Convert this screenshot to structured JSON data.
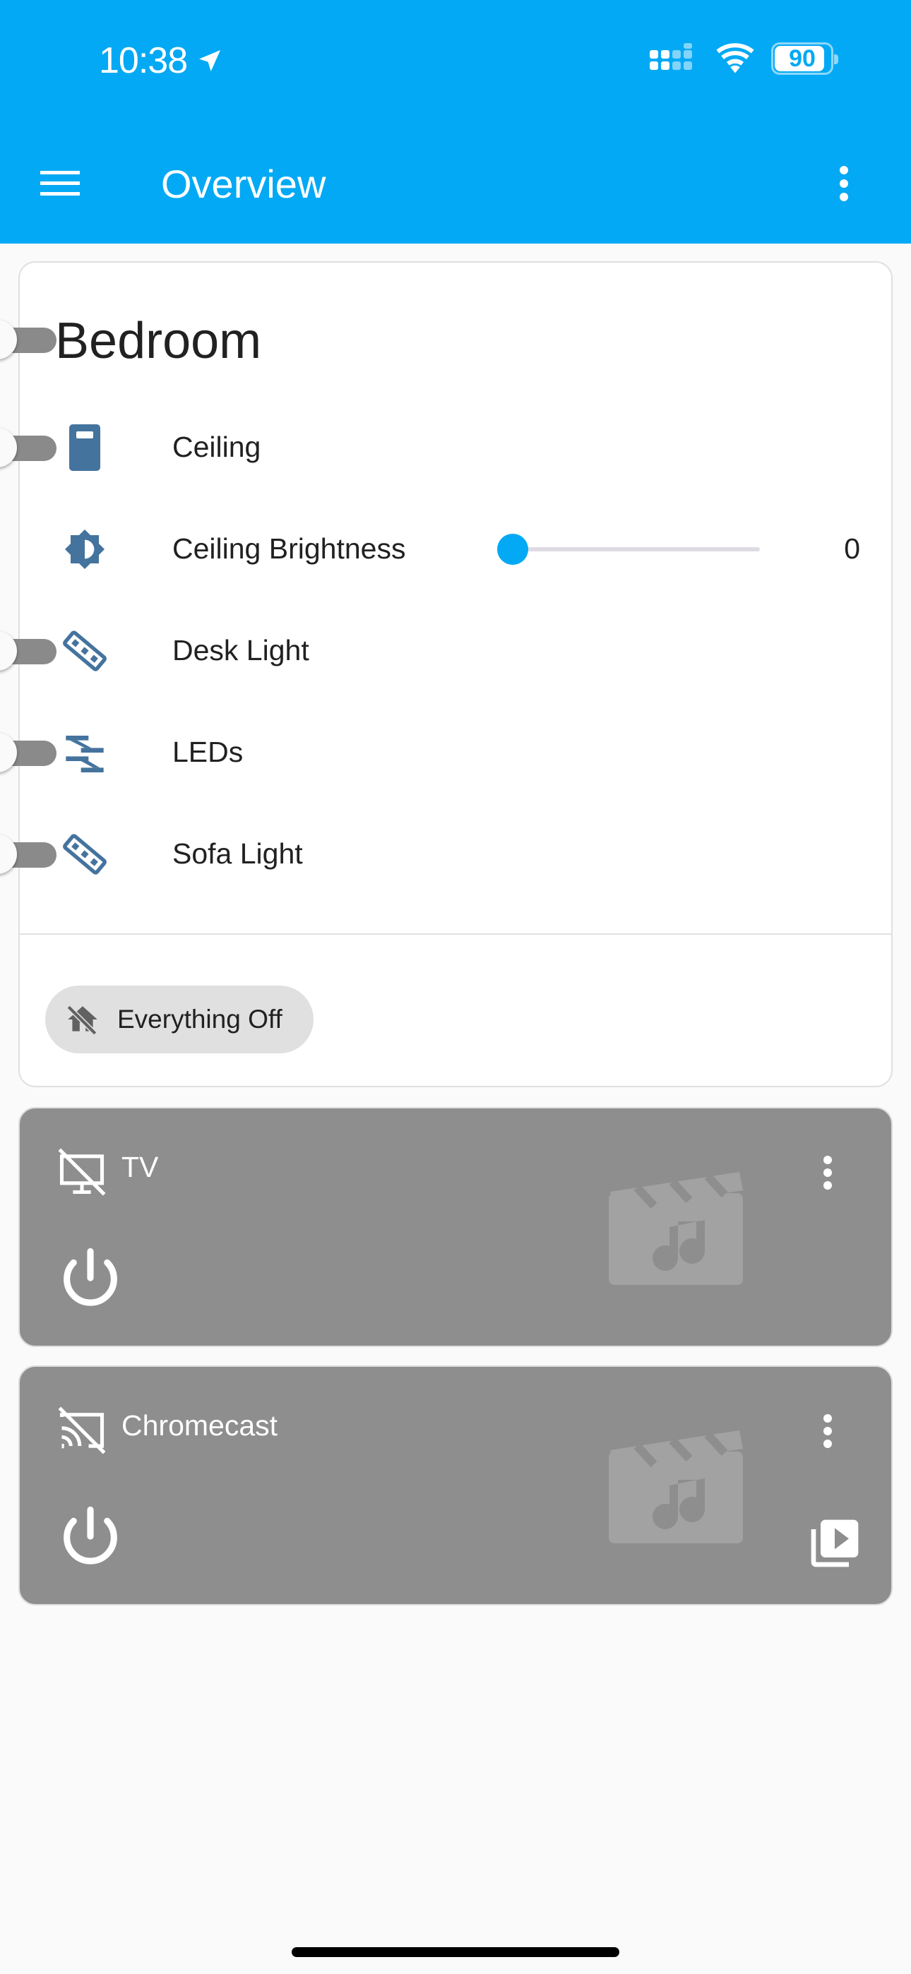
{
  "status_bar": {
    "time": "10:38",
    "battery": "90",
    "battery_level": 0.9
  },
  "toolbar": {
    "title": "Overview"
  },
  "bedroom": {
    "title": "Bedroom",
    "rows": [
      {
        "label": "Ceiling",
        "icon": "light-switch-icon"
      },
      {
        "label": "Ceiling Brightness",
        "icon": "brightness-icon",
        "value": "0"
      },
      {
        "label": "Desk Light",
        "icon": "led-strip-icon"
      },
      {
        "label": "LEDs",
        "icon": "led-strip-variant-icon"
      },
      {
        "label": "Sofa Light",
        "icon": "led-strip-icon"
      }
    ],
    "action_label": "Everything Off"
  },
  "tv": {
    "name": "TV"
  },
  "chromecast": {
    "name": "Chromecast"
  },
  "colors": {
    "header": "#03a9f4",
    "icon": "#44739e",
    "media_card": "#8e8e8e"
  }
}
